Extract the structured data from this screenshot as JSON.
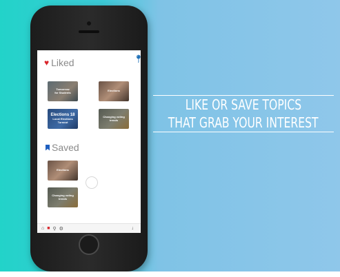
{
  "liked": {
    "title": "Liked",
    "cards": [
      {
        "lines": [
          "Tomorrow",
          "for Students"
        ]
      },
      {
        "lines": [
          "Elections"
        ]
      },
      {
        "lines": [
          "Elections 18",
          "Local Elections",
          "Turnout"
        ]
      },
      {
        "lines": [
          "Changing voting",
          "trends"
        ]
      }
    ]
  },
  "saved": {
    "title": "Saved",
    "cards": [
      {
        "lines": [
          "Elections"
        ]
      },
      {
        "lines": [
          "Changing voting",
          "trends"
        ]
      }
    ]
  },
  "tabbar": {
    "items": [
      "home-icon",
      "save-icon",
      "search-icon",
      "settings-icon",
      "download-icon"
    ]
  },
  "caption": {
    "line1": "LIKE OR SAVE TOPICS",
    "line2": "THAT GRAB YOUR INTEREST"
  },
  "colors": {
    "accent_red": "#d9252b",
    "accent_blue": "#1f5fbf",
    "background_teal": "#22d3c9",
    "background_sky": "#8fc7ea"
  }
}
